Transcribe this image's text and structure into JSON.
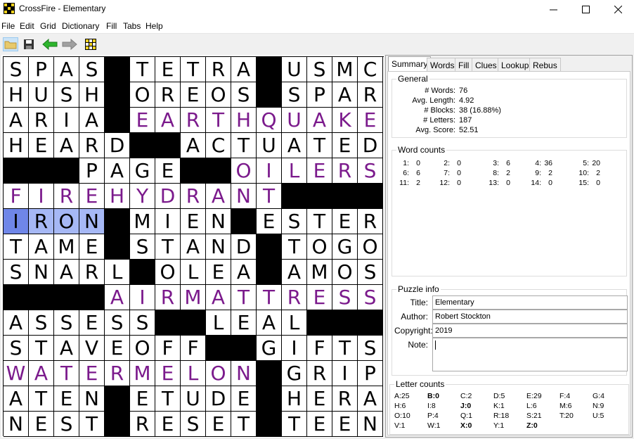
{
  "window": {
    "title": "CrossFire - Elementary",
    "minimize": "—",
    "maximize": "☐",
    "close": "✕"
  },
  "menu": [
    "File",
    "Edit",
    "Grid",
    "Dictionary",
    "Fill",
    "Tabs",
    "Help"
  ],
  "toolbar": [
    "open-folder-icon",
    "save-icon",
    "back-arrow-icon",
    "forward-arrow-icon",
    "grid-icon"
  ],
  "grid": {
    "rows": [
      "SPAS#TETRA#USMC",
      "HUSH#OREOS#SPAR",
      "ARIA#EARTHQUAKE",
      "HEARD##ACTUATED",
      "###PAGE##OILERS",
      "FIREHYDRANT####",
      "IRON#MIEN#ESTER",
      "TAME#STAND#TOGO",
      "SNARL#OLEA#AMOS",
      "####AIRMATTRESS",
      "ASSESS##LEAL###",
      "STAVEOFF##GIFTS",
      "WATERMELON#GRIP",
      "ATEN#ETUDE#HERA",
      "NEST#RESET#TEEN"
    ],
    "theme_entries": [
      {
        "row": 2,
        "col": 5,
        "len": 10
      },
      {
        "row": 4,
        "col": 9,
        "len": 6
      },
      {
        "row": 5,
        "col": 0,
        "len": 11
      },
      {
        "row": 9,
        "col": 4,
        "len": 11
      },
      {
        "row": 12,
        "col": 0,
        "len": 10
      }
    ],
    "highlight": {
      "row": 6,
      "col": 0,
      "len": 4,
      "cursor_col": 0
    }
  },
  "tabs": [
    "Summary",
    "Words",
    "Fill",
    "Clues",
    "Lookup",
    "Rebus"
  ],
  "active_tab": "Summary",
  "general": {
    "heading": "General",
    "stats": [
      {
        "label": "# Words:",
        "value": "76"
      },
      {
        "label": "Avg. Length:",
        "value": "4.92"
      },
      {
        "label": "# Blocks:",
        "value": "38  (16.88%)"
      },
      {
        "label": "# Letters:",
        "value": "187"
      },
      {
        "label": "Avg. Score:",
        "value": "52.51"
      }
    ]
  },
  "word_counts": {
    "heading": "Word counts",
    "items": [
      {
        "k": "1:",
        "v": "0"
      },
      {
        "k": "2:",
        "v": "0"
      },
      {
        "k": "3:",
        "v": "6"
      },
      {
        "k": "4:",
        "v": "36"
      },
      {
        "k": "5:",
        "v": "20"
      },
      {
        "k": "6:",
        "v": "6"
      },
      {
        "k": "7:",
        "v": "0"
      },
      {
        "k": "8:",
        "v": "2"
      },
      {
        "k": "9:",
        "v": "2"
      },
      {
        "k": "10:",
        "v": "2"
      },
      {
        "k": "11:",
        "v": "2"
      },
      {
        "k": "12:",
        "v": "0"
      },
      {
        "k": "13:",
        "v": "0"
      },
      {
        "k": "14:",
        "v": "0"
      },
      {
        "k": "15:",
        "v": "0"
      }
    ]
  },
  "puzzle_info": {
    "heading": "Puzzle info",
    "title_label": "Title:",
    "title": "Elementary",
    "author_label": "Author:",
    "author": "Robert Stockton",
    "copyright_label": "Copyright:",
    "copyright": "2019",
    "note_label": "Note:",
    "note": ""
  },
  "letter_counts": {
    "heading": "Letter counts",
    "items": [
      {
        "t": "A:25",
        "b": false
      },
      {
        "t": "B:0",
        "b": true
      },
      {
        "t": "C:2",
        "b": false
      },
      {
        "t": "D:5",
        "b": false
      },
      {
        "t": "E:29",
        "b": false
      },
      {
        "t": "F:4",
        "b": false
      },
      {
        "t": "G:4",
        "b": false
      },
      {
        "t": "H:6",
        "b": false
      },
      {
        "t": "I:8",
        "b": false
      },
      {
        "t": "J:0",
        "b": true
      },
      {
        "t": "K:1",
        "b": false
      },
      {
        "t": "L:6",
        "b": false
      },
      {
        "t": "M:6",
        "b": false
      },
      {
        "t": "N:9",
        "b": false
      },
      {
        "t": "O:10",
        "b": false
      },
      {
        "t": "P:4",
        "b": false
      },
      {
        "t": "Q:1",
        "b": false
      },
      {
        "t": "R:18",
        "b": false
      },
      {
        "t": "S:21",
        "b": false
      },
      {
        "t": "T:20",
        "b": false
      },
      {
        "t": "U:5",
        "b": false
      },
      {
        "t": "V:1",
        "b": false
      },
      {
        "t": "W:1",
        "b": false
      },
      {
        "t": "X:0",
        "b": true
      },
      {
        "t": "Y:1",
        "b": false
      },
      {
        "t": "Z:0",
        "b": true
      }
    ]
  }
}
